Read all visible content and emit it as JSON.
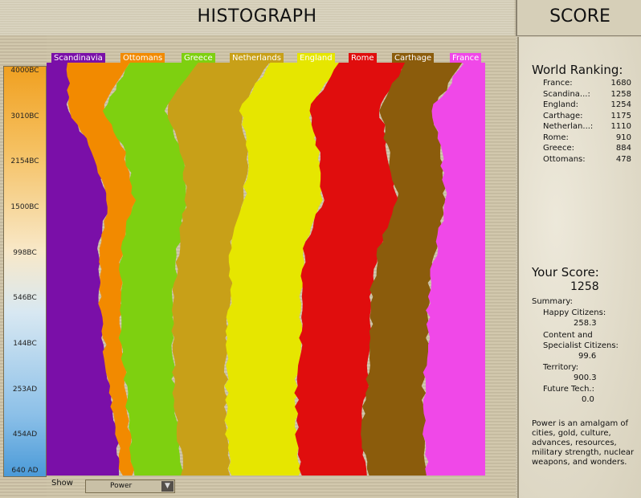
{
  "header": {
    "title": "HISTOGRAPH",
    "score_title": "SCORE"
  },
  "timescale": [
    "4000BC",
    "3010BC",
    "2154BC",
    "1500BC",
    "998BC",
    "546BC",
    "144BC",
    "253AD",
    "454AD",
    "640 AD"
  ],
  "legend": [
    {
      "label": "Scandinavia",
      "color": "#7a0fa8"
    },
    {
      "label": "Ottomans",
      "color": "#f28a00"
    },
    {
      "label": "Greece",
      "color": "#7ed010"
    },
    {
      "label": "Netherlands",
      "color": "#c8a018"
    },
    {
      "label": "England",
      "color": "#e6e600"
    },
    {
      "label": "Rome",
      "color": "#e00d0d"
    },
    {
      "label": "Carthage",
      "color": "#8b5c0c"
    },
    {
      "label": "France",
      "color": "#f048e8"
    }
  ],
  "chart_data": {
    "type": "area",
    "orientation": "vertical-time",
    "stacked": true,
    "x": [
      "4000BC",
      "3010BC",
      "2154BC",
      "1500BC",
      "998BC",
      "546BC",
      "144BC",
      "253AD",
      "454AD",
      "640 AD"
    ],
    "series": [
      {
        "name": "Scandinavia",
        "values": [
          5,
          5,
          11,
          14,
          12,
          12,
          13,
          14,
          16,
          17
        ]
      },
      {
        "name": "Ottomans",
        "values": [
          14,
          8,
          7,
          6,
          5,
          5,
          4,
          4,
          3,
          3
        ]
      },
      {
        "name": "Greece",
        "values": [
          16,
          14,
          13,
          12,
          13,
          12,
          12,
          11,
          11,
          11
        ]
      },
      {
        "name": "Netherlands",
        "values": [
          16,
          17,
          15,
          13,
          12,
          13,
          12,
          12,
          11,
          11
        ]
      },
      {
        "name": "England",
        "values": [
          16,
          16,
          16,
          18,
          17,
          16,
          17,
          16,
          16,
          16
        ]
      },
      {
        "name": "Rome",
        "values": [
          15,
          16,
          16,
          17,
          17,
          16,
          16,
          16,
          15,
          15
        ]
      },
      {
        "name": "Carthage",
        "values": [
          13,
          12,
          12,
          11,
          13,
          13,
          13,
          13,
          14,
          14
        ]
      },
      {
        "name": "France",
        "values": [
          5,
          12,
          10,
          9,
          11,
          13,
          13,
          14,
          14,
          13
        ]
      }
    ]
  },
  "controls": {
    "show_label": "Show",
    "show_value": "Power"
  },
  "ranking": {
    "title": "World Ranking:",
    "rows": [
      {
        "name": "France:",
        "score": "1680"
      },
      {
        "name": "Scandina...:",
        "score": "1258"
      },
      {
        "name": "England:",
        "score": "1254"
      },
      {
        "name": "Carthage:",
        "score": "1175"
      },
      {
        "name": "Netherlan...:",
        "score": "1110"
      },
      {
        "name": "Rome:",
        "score": "910"
      },
      {
        "name": "Greece:",
        "score": "884"
      },
      {
        "name": "Ottomans:",
        "score": "478"
      }
    ]
  },
  "your_score": {
    "title": "Your Score:",
    "value": "1258",
    "summary_label": "Summary:",
    "happy_label": "Happy Citizens:",
    "happy_value": "258.3",
    "content_label_1": "Content and",
    "content_label_2": "Specialist Citizens:",
    "content_value": "99.6",
    "territory_label": "Territory:",
    "territory_value": "900.3",
    "future_label": "Future Tech.:",
    "future_value": "0.0"
  },
  "description": "Power is an amalgam of cities, gold, culture, advances, resources, military strength, nuclear weapons, and wonders."
}
